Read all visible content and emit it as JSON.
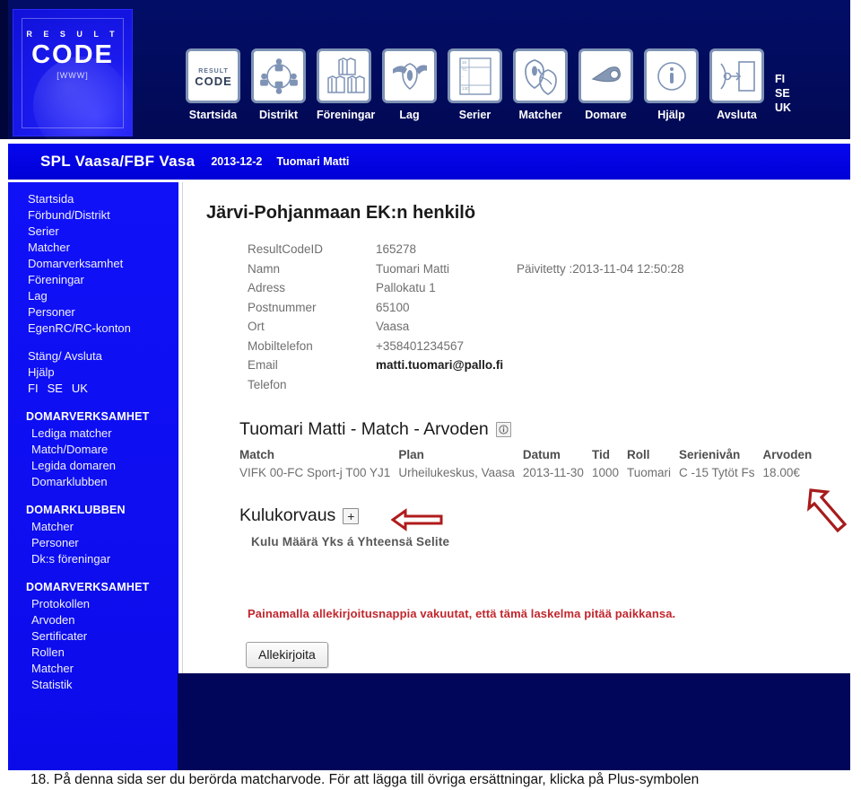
{
  "banner": {
    "logo": {
      "line1": "R E S U L T",
      "line2": "CODE",
      "line3": "[WWW]"
    },
    "toolbar": [
      {
        "label": "Startsida",
        "icon": "resultcode-logo-icon"
      },
      {
        "label": "Distrikt",
        "icon": "people-circle-icon"
      },
      {
        "label": "Föreningar",
        "icon": "jerseys-icon"
      },
      {
        "label": "Lag",
        "icon": "shield-banner-icon"
      },
      {
        "label": "Serier",
        "icon": "table-chart-icon"
      },
      {
        "label": "Matcher",
        "icon": "two-shields-icon"
      },
      {
        "label": "Domare",
        "icon": "whistle-icon"
      },
      {
        "label": "Hjälp",
        "icon": "info-circle-icon"
      },
      {
        "label": "Avsluta",
        "icon": "exit-door-icon"
      }
    ],
    "languages": [
      "FI",
      "SE",
      "UK"
    ]
  },
  "subheader": {
    "org": "SPL Vaasa/FBF Vasa",
    "date": "2013-12-2",
    "user": "Tuomari Matti"
  },
  "sidebar": {
    "main_items": [
      "Startsida",
      "Förbund/Distrikt",
      "Serier",
      "Matcher",
      "Domarverksamhet",
      "Föreningar",
      "Lag",
      "Personer",
      "EgenRC/RC-konton"
    ],
    "util_items": [
      "Stäng/ Avsluta",
      "Hjälp"
    ],
    "languages": [
      "FI",
      "SE",
      "UK"
    ],
    "groups": [
      {
        "title": "DOMARVERKSAMHET",
        "items": [
          "Lediga matcher",
          "Match/Domare",
          "Legida domaren",
          "Domarklubben"
        ]
      },
      {
        "title": "DOMARKLUBBEN",
        "items": [
          "Matcher",
          "Personer",
          "Dk:s föreningar"
        ]
      },
      {
        "title": "DOMARVERKSAMHET",
        "items": [
          "Protokollen",
          "Arvoden",
          "Sertificater",
          "Rollen",
          "Matcher",
          "Statistik"
        ]
      }
    ]
  },
  "content": {
    "page_title": "Järvi-Pohjanmaan EK:n henkilö",
    "person": {
      "rows": [
        {
          "label": "ResultCodeID",
          "value": "165278",
          "extra": ""
        },
        {
          "label": "Namn",
          "value": "Tuomari Matti",
          "extra": "Päivitetty :2013-11-04 12:50:28"
        },
        {
          "label": "Adress",
          "value": "Pallokatu 1",
          "extra": ""
        },
        {
          "label": "Postnummer",
          "value": "65100",
          "extra": ""
        },
        {
          "label": "Ort",
          "value": "Vaasa",
          "extra": ""
        },
        {
          "label": "Mobiltelefon",
          "value": "+358401234567",
          "extra": ""
        },
        {
          "label": "Email",
          "value": "matti.tuomari@pallo.fi",
          "extra": ""
        },
        {
          "label": "Telefon",
          "value": "",
          "extra": ""
        }
      ]
    },
    "arvoden": {
      "heading": "Tuomari Matti - Match - Arvoden",
      "info_icon": "info-circle-icon",
      "columns": [
        "Match",
        "Plan",
        "Datum",
        "Tid",
        "Roll",
        "Serienivån",
        "Arvoden"
      ],
      "rows": [
        {
          "match": "VIFK 00-FC Sport-j T00 YJ1",
          "plan": "Urheilukeskus, Vaasa",
          "datum": "2013-11-30",
          "tid": "1000",
          "roll": "Tuomari",
          "serieniva": "C -15 Tytöt Fs",
          "arvoden": "18.00€"
        }
      ]
    },
    "kulukorvaus": {
      "heading": "Kulukorvaus",
      "add_label": "+",
      "columns_line": "Kulu Määrä Yks á Yhteensä Selite"
    },
    "warning": "Painamalla allekirjoitusnappia vakuutat, että tämä laskelma pitää paikkansa.",
    "sign_button": "Allekirjoita"
  },
  "annotations": {
    "arrow_left": "red-left-arrow-icon",
    "arrow_diagonal": "red-diagonal-arrow-icon",
    "arrow_color": "#b01b1b"
  },
  "caption": "18. På denna sida ser du berörda matcharvode. För att lägga till övriga ersättningar, klicka på Plus-symbolen"
}
